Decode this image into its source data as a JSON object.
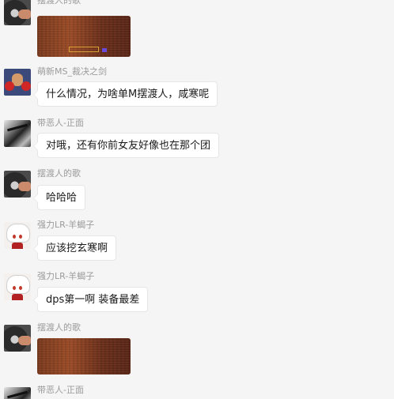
{
  "messages": [
    {
      "sender": "摆渡人的歌",
      "type": "image",
      "avatar": "steering-wheel-avatar"
    },
    {
      "sender": "萌新MS_裁决之剑",
      "type": "text",
      "text": "什么情况，为啥单M摆渡人，咸寒呢",
      "avatar": "boxer-avatar"
    },
    {
      "sender": "带恶人-正面",
      "type": "text",
      "text": "对哦，还有你前女友好像也在那个团",
      "avatar": "monochrome-avatar"
    },
    {
      "sender": "摆渡人的歌",
      "type": "text",
      "text": "哈哈哈",
      "avatar": "steering-wheel-avatar"
    },
    {
      "sender": "强力LR-羊蝎子",
      "type": "text",
      "text": "应该挖玄寒啊",
      "avatar": "anime-avatar"
    },
    {
      "sender": "强力LR-羊蝎子",
      "type": "text",
      "text": "dps第一啊 装备最差",
      "avatar": "anime-avatar"
    },
    {
      "sender": "摆渡人的歌",
      "type": "image",
      "avatar": "steering-wheel-avatar"
    },
    {
      "sender": "带恶人-正面",
      "type": "text",
      "text": "",
      "avatar": "monochrome-avatar"
    }
  ],
  "colors": {
    "background": "#f5f5f5",
    "bubble": "#ffffff",
    "bubble_border": "#e6e6e6",
    "sender_text": "#9b9b9b",
    "message_text": "#1a1a1a"
  }
}
